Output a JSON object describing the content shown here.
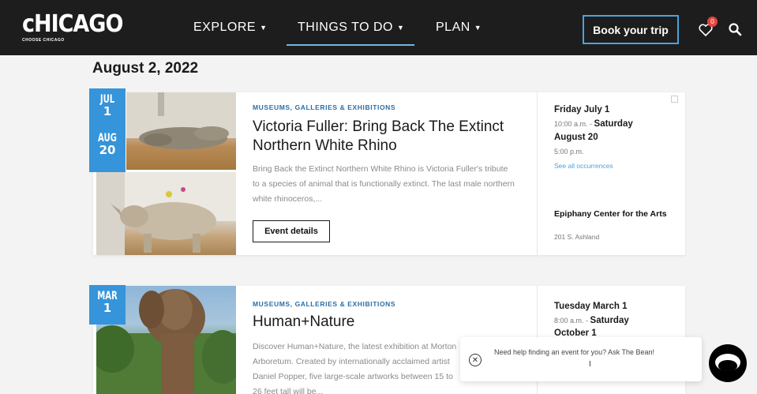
{
  "header": {
    "logo_text": "cHICAGO",
    "logo_sub": "CHOOSE CHICAGO",
    "nav": [
      {
        "label": "EXPLORE"
      },
      {
        "label": "THINGS TO DO"
      },
      {
        "label": "PLAN"
      }
    ],
    "book_label": "Book your trip",
    "favorites_count": "0"
  },
  "date_heading": "August 2, 2022",
  "events": [
    {
      "badge_start_month": "JUL",
      "badge_start_day": "1",
      "badge_end_month": "AUG",
      "badge_end_day": "20",
      "category": "MUSEUMS, GALLERIES & EXHIBITIONS",
      "title": "Victoria Fuller: Bring Back The Extinct Northern White Rhino",
      "description": "Bring Back the Extinct Northern White Rhino is Victoria Fuller's tribute to a species of animal that is functionally extinct. The last male northern white rhinoceros,...",
      "details_label": "Event details",
      "start_day": "Friday July 1",
      "start_time": "10:00 a.m. - ",
      "until_day_1": "Saturday",
      "until_day_2": "August 20",
      "end_time": "5:00 p.m.",
      "occurrences_link": "See all occurrences",
      "venue": "Epiphany Center for the Arts",
      "address": "201 S. Ashland"
    },
    {
      "badge_start_month": "MAR",
      "badge_start_day": "1",
      "category": "MUSEUMS, GALLERIES & EXHIBITIONS",
      "title": "Human+Nature",
      "description": "Discover Human+Nature, the latest exhibition at Morton Arboretum. Created by internationally acclaimed artist Daniel Popper, five large-scale artworks between 15 to 26 feet tall will be...",
      "start_day": "Tuesday March 1",
      "start_time": "8:00 a.m. - ",
      "until_day_1": "Saturday",
      "until_day_2": "October 1"
    }
  ],
  "chat": {
    "prompt": "Need help finding an event for you? Ask The Bean!"
  },
  "colors": {
    "header_bg": "#1d1d1d",
    "accent_blue": "#3594da",
    "category_blue": "#2a6fa8"
  }
}
